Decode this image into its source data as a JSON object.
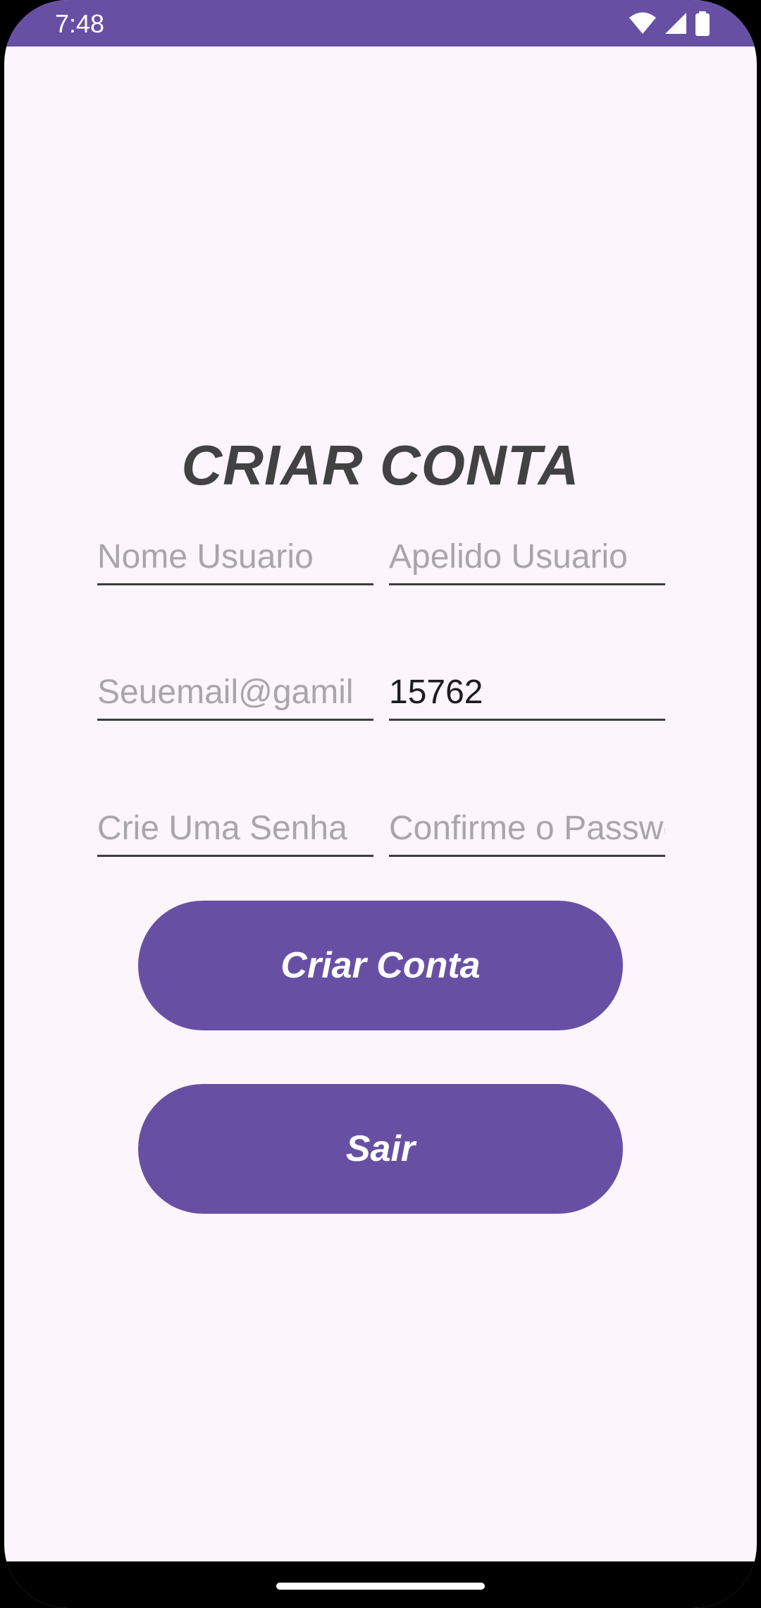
{
  "status_bar": {
    "time": "7:48",
    "icons": [
      "wifi-icon",
      "cellular-signal-icon",
      "battery-icon"
    ],
    "background": "#6750A4"
  },
  "form": {
    "title": "CRIAR CONTA",
    "nome_usuario": {
      "placeholder": "Nome Usuario",
      "value": ""
    },
    "apelido_usuario": {
      "placeholder": "Apelido Usuario",
      "value": ""
    },
    "email": {
      "placeholder": "Seuemail@gamil",
      "value": ""
    },
    "numero": {
      "placeholder": "",
      "value": "15762"
    },
    "senha": {
      "placeholder": "Crie Uma Senha",
      "value": ""
    },
    "confirmar_senha": {
      "placeholder": "Confirme o Password",
      "value": ""
    }
  },
  "buttons": {
    "criar_conta": "Criar Conta",
    "sair": "Sair"
  },
  "colors": {
    "primary": "#6750A4",
    "background": "#FCF5FB",
    "title": "#424242",
    "placeholder": "#A9A6AB"
  }
}
